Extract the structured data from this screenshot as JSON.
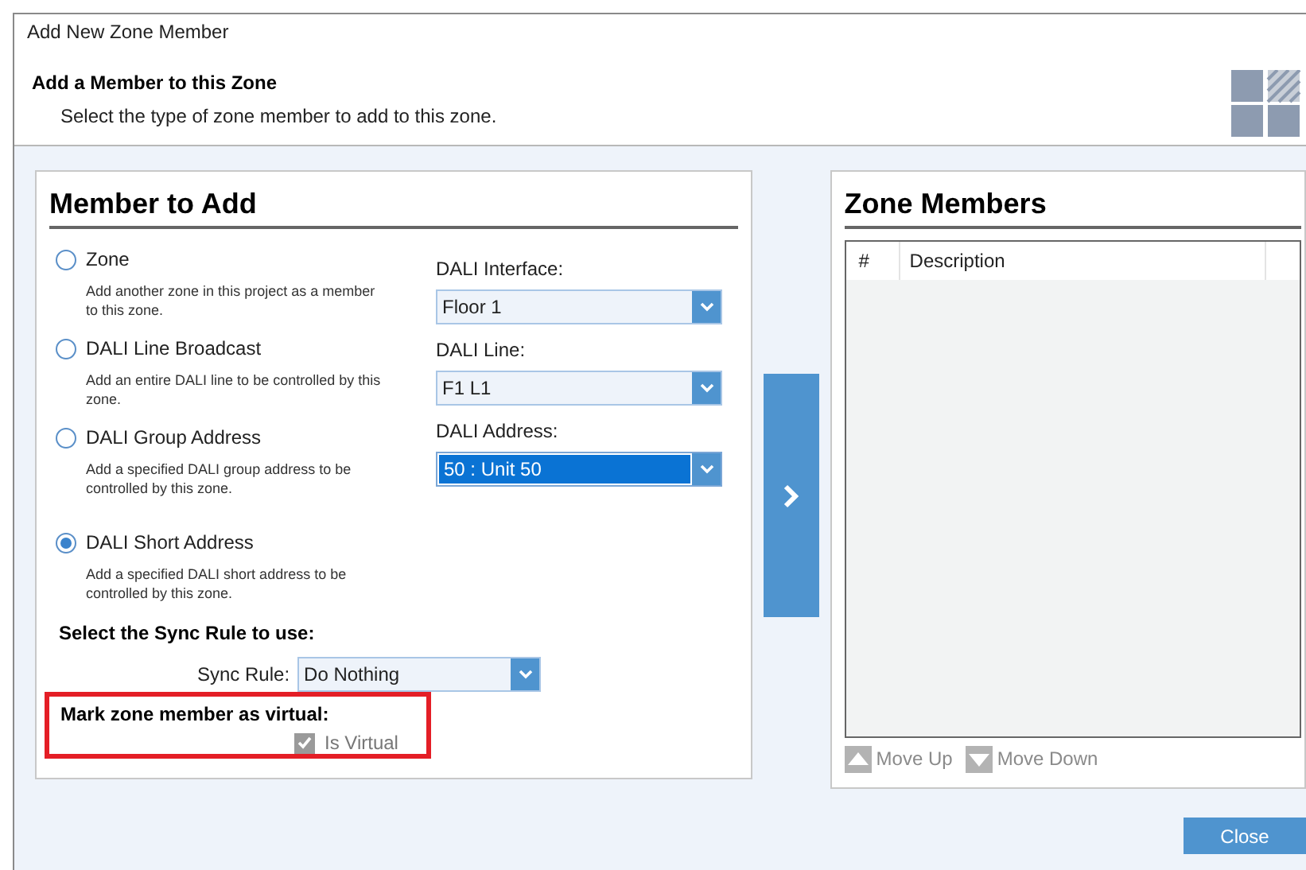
{
  "window": {
    "title": "Add New Zone Member"
  },
  "header": {
    "title": "Add a Member to this Zone",
    "subtitle": "Select the type of zone member to add to this zone."
  },
  "member_panel": {
    "title": "Member to Add",
    "options": [
      {
        "label": "Zone",
        "description": "Add another zone in this project as a member to this zone.",
        "selected": false
      },
      {
        "label": "DALI Line Broadcast",
        "description": "Add an entire DALI line to be controlled by this zone.",
        "selected": false
      },
      {
        "label": "DALI Group Address",
        "description": "Add a specified DALI group address to be controlled by this zone.",
        "selected": false
      },
      {
        "label": "DALI Short Address",
        "description": "Add a specified DALI short address to be controlled by this zone.",
        "selected": true
      }
    ],
    "fields": [
      {
        "label": "DALI Interface:",
        "value": "Floor 1",
        "focused": false
      },
      {
        "label": "DALI Line:",
        "value": "F1 L1",
        "focused": false
      },
      {
        "label": "DALI Address:",
        "value": "50 : Unit 50",
        "focused": true
      }
    ],
    "sync_heading": "Select the Sync Rule to use:",
    "sync_rule": {
      "label": "Sync Rule:",
      "value": "Do Nothing"
    },
    "virtual": {
      "heading": "Mark zone member as virtual:",
      "label": "Is Virtual",
      "checked": true,
      "disabled": true
    }
  },
  "members_panel": {
    "title": "Zone Members",
    "columns": [
      "#",
      "Description"
    ],
    "actions": [
      {
        "label": "Move Up",
        "kind": "up",
        "disabled": true
      },
      {
        "label": "Move Down",
        "kind": "down",
        "disabled": true
      }
    ]
  },
  "buttons": {
    "close": "Close"
  }
}
